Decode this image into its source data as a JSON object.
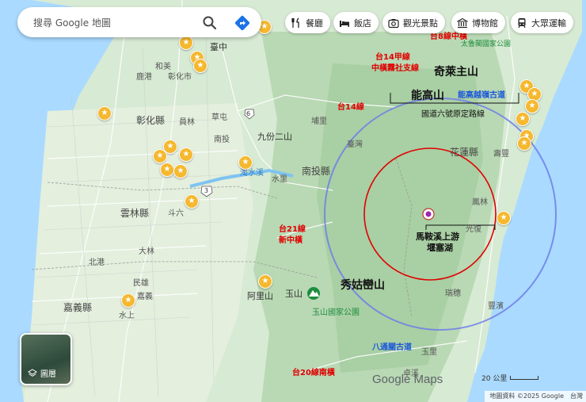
{
  "search": {
    "placeholder": "搜尋 Google 地圖"
  },
  "icons": {
    "search": "search-icon",
    "directions": "directions-icon",
    "layers": "layers-icon"
  },
  "chips": [
    {
      "label": "餐廳",
      "icon": "fork-knife-icon"
    },
    {
      "label": "飯店",
      "icon": "bed-icon"
    },
    {
      "label": "觀光景點",
      "icon": "camera-icon"
    },
    {
      "label": "博物館",
      "icon": "museum-icon"
    },
    {
      "label": "大眾運輸",
      "icon": "transit-icon"
    }
  ],
  "layers": {
    "label": "圖層"
  },
  "places": {
    "taichung": "臺中",
    "hemei": "和美",
    "lukang": "鹿港",
    "changhua_city": "彰化市",
    "changhua_county": "彰化縣",
    "yuanlin": "員林",
    "nantou_town": "南投",
    "caotun": "草屯",
    "puli": "埔里",
    "jiufen_ershan": "九份二山",
    "nantou_county": "南投縣",
    "shuili": "水里",
    "zhuoshui": "濁水溪",
    "douliu": "斗六",
    "yunlin_county": "雲林縣",
    "dalin": "大林",
    "beigang": "北港",
    "minxiong": "民雄",
    "chiayi": "嘉義",
    "chiayi_county": "嘉義縣",
    "shuishang": "水上",
    "alishan": "阿里山",
    "yushan": "玉山",
    "yushan_park": "玉山國家公園",
    "xiuguluan": "秀姑巒山",
    "hualien_county": "花蓮縣",
    "shoufeng": "壽豐",
    "fenglin": "鳳林",
    "guangfu": "光復",
    "ruisui": "瑞穗",
    "fengbin": "豐濱",
    "yuli": "玉里",
    "zhuoxi": "卓溪",
    "taroko": "太魯閣國家公園",
    "qilai": "奇萊主山",
    "nenggao": "能高山",
    "route6": "國道六號原定路線",
    "luoshan": "臺灣",
    "road6": "6",
    "road3": "3"
  },
  "annotations": {
    "cross_island_8": "台8線中橫",
    "wushe_branch_1": "台14甲線",
    "wushe_branch_2": "中橫霧社支線",
    "route14": "台14線",
    "route21_1": "台21線",
    "route21_2": "新中橫",
    "route20": "台20線南橫",
    "nenggao_trail": "能高越嶺古道",
    "batongguan": "八通關古道",
    "lake_1": "馬鞍溪上游",
    "lake_2": "堰塞湖"
  },
  "logo": "Google Maps",
  "scale": "20 公里",
  "attribution": {
    "data": "地圖資料 ©2025 Google",
    "region": "台灣"
  }
}
